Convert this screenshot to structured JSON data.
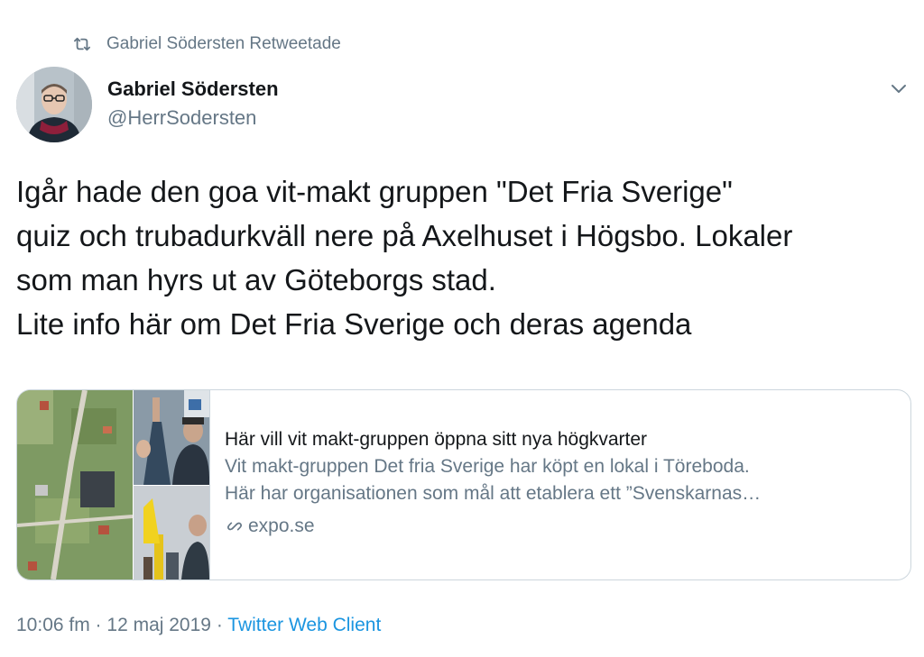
{
  "retweet": {
    "icon": "retweet-icon",
    "label": "Gabriel Södersten Retweetade"
  },
  "author": {
    "name": "Gabriel Södersten",
    "handle": "@HerrSodersten",
    "avatar_icon": "avatar"
  },
  "menu": {
    "icon": "chevron-down-icon"
  },
  "tweet": {
    "lines": [
      "Igår hade den goa vit-makt gruppen \"Det Fria Sverige\"",
      "quiz och trubadurkväll nere på Axelhuset i Högsbo. Lokaler",
      "som man hyrs ut av Göteborgs stad.",
      "Lite info här om Det Fria Sverige och deras agenda"
    ]
  },
  "card": {
    "title": "Här vill vit makt-gruppen öppna sitt nya högkvarter",
    "desc_line1": "Vit makt-gruppen Det fria Sverige har köpt en lokal i Töreboda.",
    "desc_line2": "Här har organisationen som mål att etablera ett ”Svenskarnas…",
    "domain": "expo.se",
    "link_icon": "link-icon"
  },
  "meta": {
    "time": "10:06 fm",
    "separator1": " · ",
    "date": "12 maj 2019",
    "separator2": " · ",
    "source": "Twitter Web Client"
  },
  "colors": {
    "text": "#14171a",
    "secondary": "#657786",
    "link": "#1b95e0",
    "border": "#ccd6dd"
  }
}
